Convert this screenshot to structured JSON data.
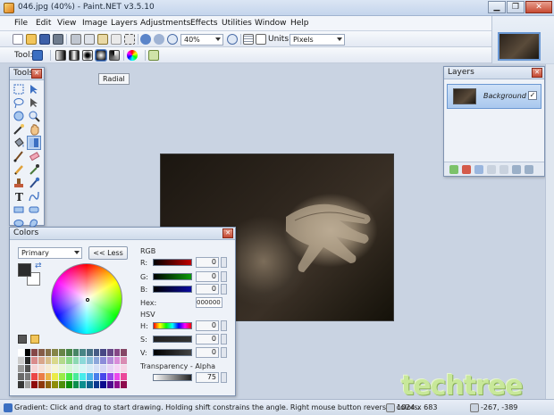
{
  "window": {
    "title": "046.jpg (40%) - Paint.NET v3.5.10",
    "buttons": {
      "minimize": "▁",
      "restore": "❐",
      "close": "✕"
    }
  },
  "menu": {
    "items": [
      "File",
      "Edit",
      "View",
      "Image",
      "Layers",
      "Adjustments",
      "Effects",
      "Utilities",
      "Window",
      "Help"
    ]
  },
  "toolbar": {
    "zoom": "40%",
    "units_label": "Units:",
    "units_value": "Pixels",
    "tool_label": "Tool:"
  },
  "tooltip": "Radial",
  "tools_panel": {
    "title": "Tools"
  },
  "layers_panel": {
    "title": "Layers",
    "layers": [
      {
        "name": "Background",
        "visible": true
      }
    ]
  },
  "colors_panel": {
    "title": "Colors",
    "mode": "Primary",
    "less_button": "<< Less",
    "rgb_label": "RGB",
    "r_label": "R:",
    "r_value": "0",
    "g_label": "G:",
    "g_value": "0",
    "b_label": "B:",
    "b_value": "0",
    "hex_label": "Hex:",
    "hex_value": "000000",
    "hsv_label": "HSV",
    "h_label": "H:",
    "h_value": "0",
    "s_label": "S:",
    "s_value": "0",
    "v_label": "V:",
    "v_value": "0",
    "alpha_label": "Transparency - Alpha",
    "alpha_value": "75"
  },
  "status": {
    "hint": "Gradient: Click and drag to start drawing. Holding shift constrains the angle. Right mouse button reverses colors.",
    "size": "1024 x 683",
    "coords": "-267, -389"
  },
  "watermark": "techtree",
  "colors": {
    "accent": "#6a98d4",
    "panel_bg": "#eef2f8",
    "workspace": "#c9d3e2"
  }
}
